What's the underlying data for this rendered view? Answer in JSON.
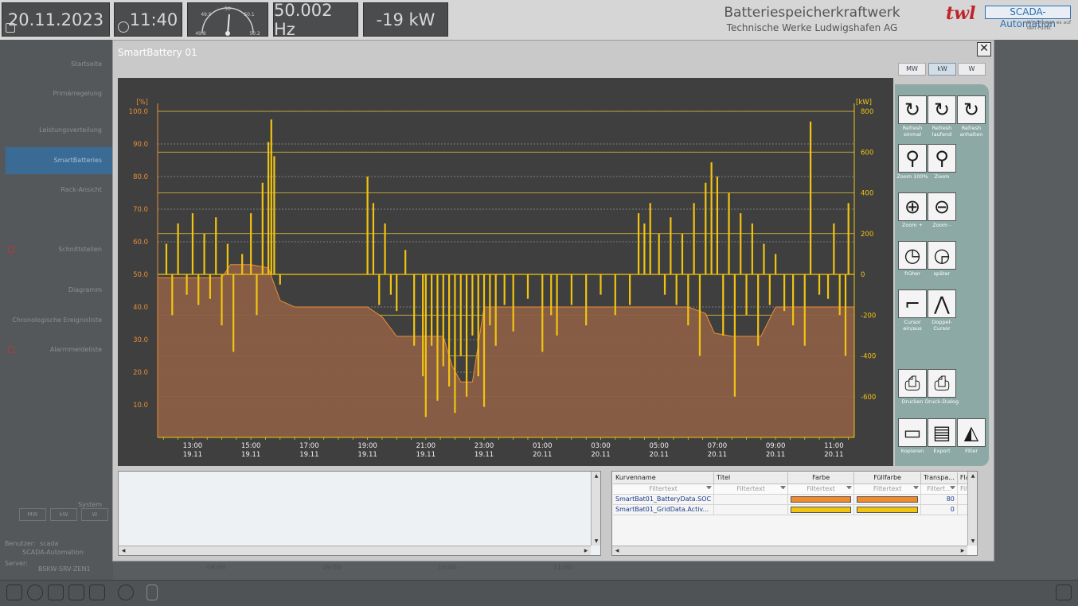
{
  "header": {
    "date": "20.11.2023",
    "time": "11:40",
    "frequency_gauge": {
      "top_label": "50",
      "left_upper": "49.9",
      "right_upper": "50.1",
      "left_lower": "49.8",
      "right_lower": "50.2"
    },
    "frequency": "50.002 Hz",
    "power": "-19 kW",
    "plant_title": "Batteriespeicherkraftwerk",
    "plant_subtitle": "Technische Werke Ludwigshafen AG",
    "logo_text": "twl",
    "partner_logo": "SCADA-Automation",
    "partner_slogan": "Wir bringen es auf den Punkt"
  },
  "sidebar": {
    "items": [
      {
        "label": "Startseite"
      },
      {
        "label": "Primärregelung"
      },
      {
        "label": "Leistungsverteilung"
      },
      {
        "label": "SmartBatteries"
      },
      {
        "label": "Rack-Ansicht"
      },
      {
        "label": "Schnittstellen"
      },
      {
        "label": "Diagramm"
      },
      {
        "label": "Chronologische Ereignisliste"
      },
      {
        "label": "Alarmmeldeliste"
      }
    ],
    "units": [
      "MW",
      "kW",
      "W"
    ],
    "system_label": "System",
    "user_label": "Benutzer:",
    "user_name": "scada",
    "user_org": "SCADA-Automation",
    "server_label": "Server:",
    "server_name": "BSKW-SRV-ZEN1"
  },
  "background_axis": [
    "08:00",
    "09:00",
    "10:00",
    "11:00"
  ],
  "modal": {
    "title": "SmartBattery 01",
    "close_symbol": "✕",
    "units": [
      "MW",
      "kW",
      "W"
    ],
    "selected_unit": "kW",
    "toolbar": [
      {
        "label": "Refresh einmal",
        "icon": "refresh-once-icon"
      },
      {
        "label": "Refresh laufend",
        "icon": "refresh-continuous-icon"
      },
      {
        "label": "Refresh anhalten",
        "icon": "refresh-stop-icon"
      },
      {
        "label": "Zoom 100%",
        "icon": "zoom-100-icon"
      },
      {
        "label": "Zoom",
        "icon": "zoom-icon"
      },
      {
        "label": "Zoom +",
        "icon": "zoom-in-icon"
      },
      {
        "label": "Zoom -",
        "icon": "zoom-out-icon"
      },
      {
        "label": "früher",
        "icon": "earlier-icon"
      },
      {
        "label": "später",
        "icon": "later-icon"
      },
      {
        "label": "Cursor ein/aus",
        "icon": "cursor-icon"
      },
      {
        "label": "Doppel-Cursor",
        "icon": "double-cursor-icon"
      },
      {
        "label": "Drucken",
        "icon": "print-icon"
      },
      {
        "label": "Druck-Dialog",
        "icon": "print-dialog-icon"
      },
      {
        "label": "Kopieren",
        "icon": "copy-icon"
      },
      {
        "label": "Export",
        "icon": "export-icon"
      },
      {
        "label": "Filter",
        "icon": "filter-icon"
      }
    ],
    "grid": {
      "columns": [
        "Kurvenname",
        "Titel",
        "Farbe",
        "Füllfarbe",
        "Transpa...",
        "Fla"
      ],
      "filter_placeholder": "Filtertext",
      "filter_short": "Filtert...",
      "filter_tiny": "Filt",
      "rows": [
        {
          "name": "SmartBat01_BatteryData.SOC",
          "title": "",
          "color": "#f08a2c",
          "fill": "#f08a2c",
          "transparency": "80"
        },
        {
          "name": "SmartBat01_GridData.Activ...",
          "title": "",
          "color": "#f2c40f",
          "fill": "#f2c40f",
          "transparency": "0"
        }
      ]
    }
  },
  "chart_data": {
    "type": "area",
    "left_axis": {
      "unit": "[%]",
      "ticks": [
        "100.0",
        "90.0",
        "80.0",
        "70.0",
        "60.0",
        "50.0",
        "40.0",
        "30.0",
        "20.0",
        "10.0"
      ],
      "range": [
        0,
        100
      ]
    },
    "right_axis": {
      "unit": "[kW]",
      "ticks": [
        "800",
        "600",
        "400",
        "200",
        "0",
        "-200",
        "-400",
        "-600"
      ],
      "range": [
        -800,
        800
      ]
    },
    "x_ticks": [
      {
        "time": "13:00",
        "date": "19.11"
      },
      {
        "time": "15:00",
        "date": "19.11"
      },
      {
        "time": "17:00",
        "date": "19.11"
      },
      {
        "time": "19:00",
        "date": "19.11"
      },
      {
        "time": "21:00",
        "date": "19.11"
      },
      {
        "time": "23:00",
        "date": "19.11"
      },
      {
        "time": "01:00",
        "date": "20.11"
      },
      {
        "time": "03:00",
        "date": "20.11"
      },
      {
        "time": "05:00",
        "date": "20.11"
      },
      {
        "time": "07:00",
        "date": "20.11"
      },
      {
        "time": "09:00",
        "date": "20.11"
      },
      {
        "time": "11:00",
        "date": "20.11"
      }
    ],
    "x_range_hours": [
      11.8,
      35.7
    ],
    "grid": true,
    "series": [
      {
        "axis": "left",
        "color": "#e88d36",
        "style": "area",
        "points": [
          [
            11.8,
            49
          ],
          [
            13.0,
            49
          ],
          [
            14.0,
            49
          ],
          [
            14.3,
            53
          ],
          [
            15.0,
            53
          ],
          [
            15.6,
            52
          ],
          [
            16.0,
            42
          ],
          [
            16.5,
            40
          ],
          [
            18.0,
            40
          ],
          [
            19.0,
            40
          ],
          [
            19.5,
            37
          ],
          [
            20.0,
            31
          ],
          [
            21.0,
            31
          ],
          [
            21.6,
            31
          ],
          [
            21.9,
            22
          ],
          [
            22.2,
            17
          ],
          [
            22.6,
            17
          ],
          [
            23.0,
            40
          ],
          [
            24.5,
            40
          ],
          [
            26.0,
            40
          ],
          [
            27.0,
            40
          ],
          [
            28.0,
            40
          ],
          [
            29.0,
            40
          ],
          [
            30.0,
            40
          ],
          [
            30.6,
            38
          ],
          [
            30.9,
            32
          ],
          [
            31.5,
            31
          ],
          [
            32.5,
            31
          ],
          [
            33.0,
            40
          ],
          [
            34.0,
            40
          ],
          [
            35.0,
            40
          ],
          [
            35.7,
            40
          ]
        ]
      },
      {
        "axis": "right",
        "color": "#f2c40f",
        "style": "spikes",
        "spikes": [
          [
            12.1,
            150
          ],
          [
            12.3,
            -200
          ],
          [
            12.5,
            250
          ],
          [
            12.8,
            -100
          ],
          [
            13.0,
            300
          ],
          [
            13.2,
            -150
          ],
          [
            13.4,
            200
          ],
          [
            13.6,
            -120
          ],
          [
            13.8,
            280
          ],
          [
            14.0,
            -250
          ],
          [
            14.2,
            150
          ],
          [
            14.4,
            -380
          ],
          [
            14.7,
            100
          ],
          [
            15.0,
            300
          ],
          [
            15.2,
            -200
          ],
          [
            15.4,
            450
          ],
          [
            15.6,
            650
          ],
          [
            15.7,
            760
          ],
          [
            15.8,
            580
          ],
          [
            16.0,
            -50
          ],
          [
            19.0,
            480
          ],
          [
            19.2,
            350
          ],
          [
            19.4,
            -150
          ],
          [
            19.6,
            250
          ],
          [
            19.8,
            -100
          ],
          [
            20.0,
            -180
          ],
          [
            20.3,
            120
          ],
          [
            20.6,
            -350
          ],
          [
            20.9,
            -500
          ],
          [
            21.0,
            -700
          ],
          [
            21.2,
            -350
          ],
          [
            21.4,
            -620
          ],
          [
            21.6,
            -450
          ],
          [
            21.8,
            -550
          ],
          [
            22.0,
            -680
          ],
          [
            22.2,
            -400
          ],
          [
            22.4,
            -600
          ],
          [
            22.6,
            -300
          ],
          [
            22.8,
            -500
          ],
          [
            23.0,
            -650
          ],
          [
            23.2,
            -250
          ],
          [
            23.4,
            -350
          ],
          [
            23.7,
            -150
          ],
          [
            24.0,
            -280
          ],
          [
            24.5,
            -120
          ],
          [
            25.0,
            -380
          ],
          [
            25.3,
            -200
          ],
          [
            25.5,
            -300
          ],
          [
            26.0,
            -150
          ],
          [
            26.5,
            -250
          ],
          [
            27.0,
            -100
          ],
          [
            27.5,
            -200
          ],
          [
            28.0,
            -150
          ],
          [
            28.3,
            300
          ],
          [
            28.5,
            250
          ],
          [
            28.7,
            350
          ],
          [
            29.0,
            200
          ],
          [
            29.2,
            -100
          ],
          [
            29.4,
            280
          ],
          [
            29.6,
            -150
          ],
          [
            29.8,
            200
          ],
          [
            30.0,
            -250
          ],
          [
            30.2,
            350
          ],
          [
            30.4,
            -400
          ],
          [
            30.6,
            450
          ],
          [
            30.8,
            550
          ],
          [
            31.0,
            480
          ],
          [
            31.2,
            -300
          ],
          [
            31.4,
            400
          ],
          [
            31.6,
            -600
          ],
          [
            31.8,
            300
          ],
          [
            32.0,
            -200
          ],
          [
            32.2,
            250
          ],
          [
            32.4,
            -350
          ],
          [
            32.6,
            150
          ],
          [
            32.8,
            -150
          ],
          [
            33.0,
            100
          ],
          [
            33.3,
            -180
          ],
          [
            33.6,
            -250
          ],
          [
            34.0,
            -350
          ],
          [
            34.2,
            750
          ],
          [
            34.5,
            -100
          ],
          [
            34.8,
            -120
          ],
          [
            35.0,
            250
          ],
          [
            35.2,
            -200
          ],
          [
            35.4,
            -400
          ],
          [
            35.5,
            350
          ]
        ]
      }
    ]
  }
}
